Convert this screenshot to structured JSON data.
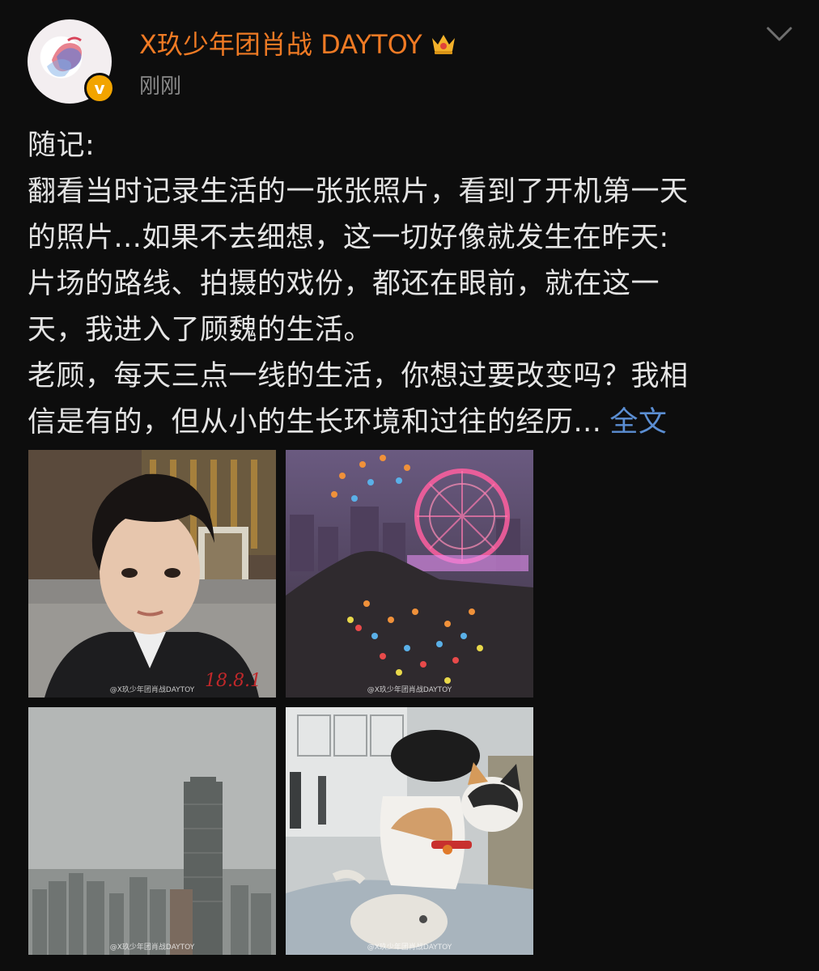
{
  "post": {
    "author": "X玖少年团肖战 DAYTOY",
    "timestamp": "刚刚",
    "verified_badge": "v",
    "text_lines": [
      "随记:",
      "翻看当时记录生活的一张张照片，看到了开机第一天",
      "的照片...如果不去细想，这一切好像就发生在昨天:",
      "片场的路线、拍摄的戏份，都还在眼前，就在这一",
      "天，我进入了顾魏的生活。",
      "老顾，每天三点一线的生活，你想过要改变吗？我相",
      "信是有的，但从小的生长环境和过往的经历..."
    ],
    "full_text_link": "全文"
  },
  "photos": [
    {
      "name": "selfie-photo",
      "watermark": "@X玖少年团肖战DAYTOY",
      "date_stamp": "18.8.1"
    },
    {
      "name": "ferris-wheel-photo",
      "watermark": "@X玖少年团肖战DAYTOY"
    },
    {
      "name": "skyline-photo",
      "watermark": "@X玖少年团肖战DAYTOY"
    },
    {
      "name": "cat-photo",
      "watermark": "@X玖少年团肖战DAYTOY"
    }
  ],
  "icons": {
    "crown": "crown-icon",
    "chevron": "chevron-down-icon",
    "verified": "verified-icon"
  },
  "colors": {
    "background": "#0d0d0d",
    "username": "#ef7a24",
    "link": "#5b8ed2",
    "badge": "#f2a400"
  }
}
